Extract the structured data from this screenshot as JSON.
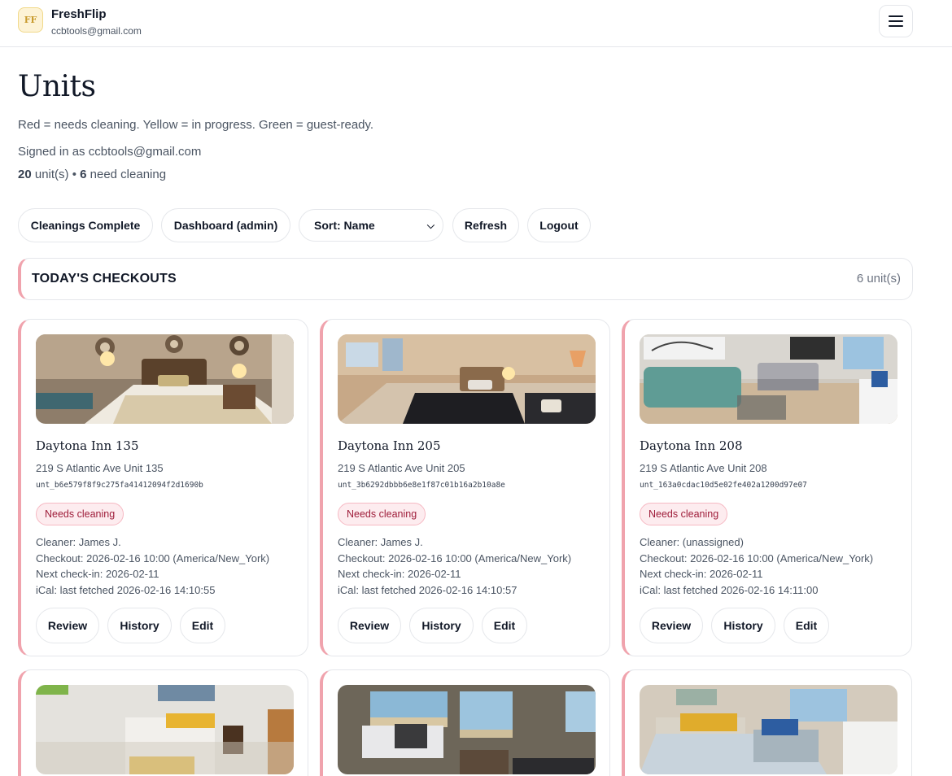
{
  "app": {
    "logo_text": "FF",
    "brand": "FreshFlip",
    "email": "ccbtools@gmail.com",
    "menu_icon": "hamburger-icon"
  },
  "page": {
    "title": "Units",
    "legend": "Red = needs cleaning. Yellow = in progress. Green = guest-ready.",
    "signed_in": "Signed in as ccbtools@gmail.com",
    "unit_count": "20",
    "unit_count_suffix": " unit(s) • ",
    "need_cleaning_count": "6",
    "need_cleaning_suffix": " need cleaning"
  },
  "toolbar": {
    "cleanings_complete": "Cleanings Complete",
    "dashboard": "Dashboard (admin)",
    "sort_selected": "Sort: Name",
    "refresh": "Refresh",
    "logout": "Logout"
  },
  "section": {
    "title": "TODAY'S CHECKOUTS",
    "count": "6 unit(s)",
    "accent_color": "#f0a3ad"
  },
  "units": [
    {
      "name": "Daytona Inn 135",
      "address": "219 S Atlantic Ave Unit 135",
      "id": "unt_b6e579f8f9c275fa41412094f2d1690b",
      "status": "Needs cleaning",
      "cleaner": "Cleaner: James J.",
      "checkout": "Checkout: 2026-02-16 10:00 (America/New_York)",
      "next_checkin": "Next check-in: 2026-02-11",
      "ical": "iCal: last fetched 2026-02-16 14:10:55",
      "review": "Review",
      "history": "History",
      "edit": "Edit"
    },
    {
      "name": "Daytona Inn 205",
      "address": "219 S Atlantic Ave Unit 205",
      "id": "unt_3b6292dbbb6e8e1f87c01b16a2b10a8e",
      "status": "Needs cleaning",
      "cleaner": "Cleaner: James J.",
      "checkout": "Checkout: 2026-02-16 10:00 (America/New_York)",
      "next_checkin": "Next check-in: 2026-02-11",
      "ical": "iCal: last fetched 2026-02-16 14:10:57",
      "review": "Review",
      "history": "History",
      "edit": "Edit"
    },
    {
      "name": "Daytona Inn 208",
      "address": "219 S Atlantic Ave Unit 208",
      "id": "unt_163a0cdac10d5e02fe402a1200d97e07",
      "status": "Needs cleaning",
      "cleaner": "Cleaner: (unassigned)",
      "checkout": "Checkout: 2026-02-16 10:00 (America/New_York)",
      "next_checkin": "Next check-in: 2026-02-11",
      "ical": "iCal: last fetched 2026-02-16 14:11:00",
      "review": "Review",
      "history": "History",
      "edit": "Edit"
    }
  ],
  "colors": {
    "needs_cleaning_bg": "#fdecef",
    "needs_cleaning_text": "#9f1d3a",
    "border": "#e5e7eb"
  }
}
